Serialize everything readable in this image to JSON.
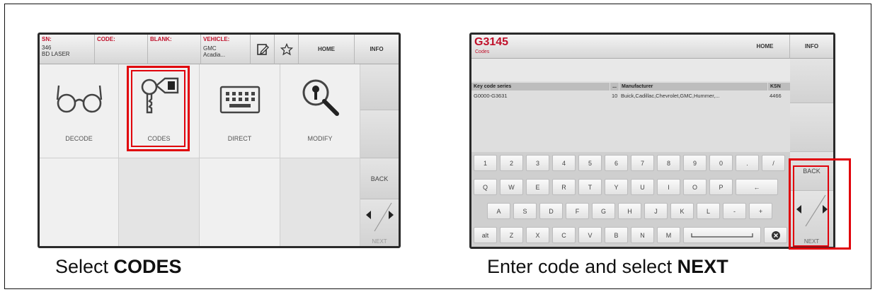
{
  "left_screen": {
    "header": {
      "sn_label": "SN:",
      "sn_value_1": "346",
      "sn_value_2": "BD LASER",
      "code_label": "CODE:",
      "blank_label": "BLANK:",
      "vehicle_label": "VEHICLE:",
      "vehicle_value_1": "GMC",
      "vehicle_value_2": "Acadia...",
      "home": "HOME",
      "info": "INFO"
    },
    "tiles": [
      "DECODE",
      "CODES",
      "DIRECT",
      "MODIFY"
    ],
    "back": "BACK",
    "next": "NEXT"
  },
  "left_caption": {
    "prefix": "Select ",
    "bold": "CODES"
  },
  "right_screen": {
    "title": "G3145",
    "subtitle": "Codes",
    "home": "HOME",
    "info": "INFO",
    "columns": {
      "series": "Key code series",
      "dash": "...",
      "manufacturer": "Manufacturer",
      "ksn": "KSN"
    },
    "row": {
      "series": "G0000-G3631",
      "num": "10",
      "manufacturer": "Buick,Cadillac,Chevrolet,GMC,Hummer,...",
      "ksn": "4466"
    },
    "keys_row1": [
      "1",
      "2",
      "3",
      "4",
      "5",
      "6",
      "7",
      "8",
      "9",
      "0",
      ".",
      "/"
    ],
    "keys_row2": [
      "Q",
      "W",
      "E",
      "R",
      "T",
      "Y",
      "U",
      "I",
      "O",
      "P",
      "←"
    ],
    "keys_row3": [
      "A",
      "S",
      "D",
      "F",
      "G",
      "H",
      "J",
      "K",
      "L",
      "-",
      "+"
    ],
    "keys_row4": [
      "alt",
      "Z",
      "X",
      "C",
      "V",
      "B",
      "N",
      "M"
    ],
    "back": "BACK",
    "next": "NEXT"
  },
  "right_caption": {
    "prefix": "Enter code and select ",
    "bold": "NEXT"
  },
  "colors": {
    "highlight": "#e0000a",
    "header_red": "#c0102a"
  }
}
